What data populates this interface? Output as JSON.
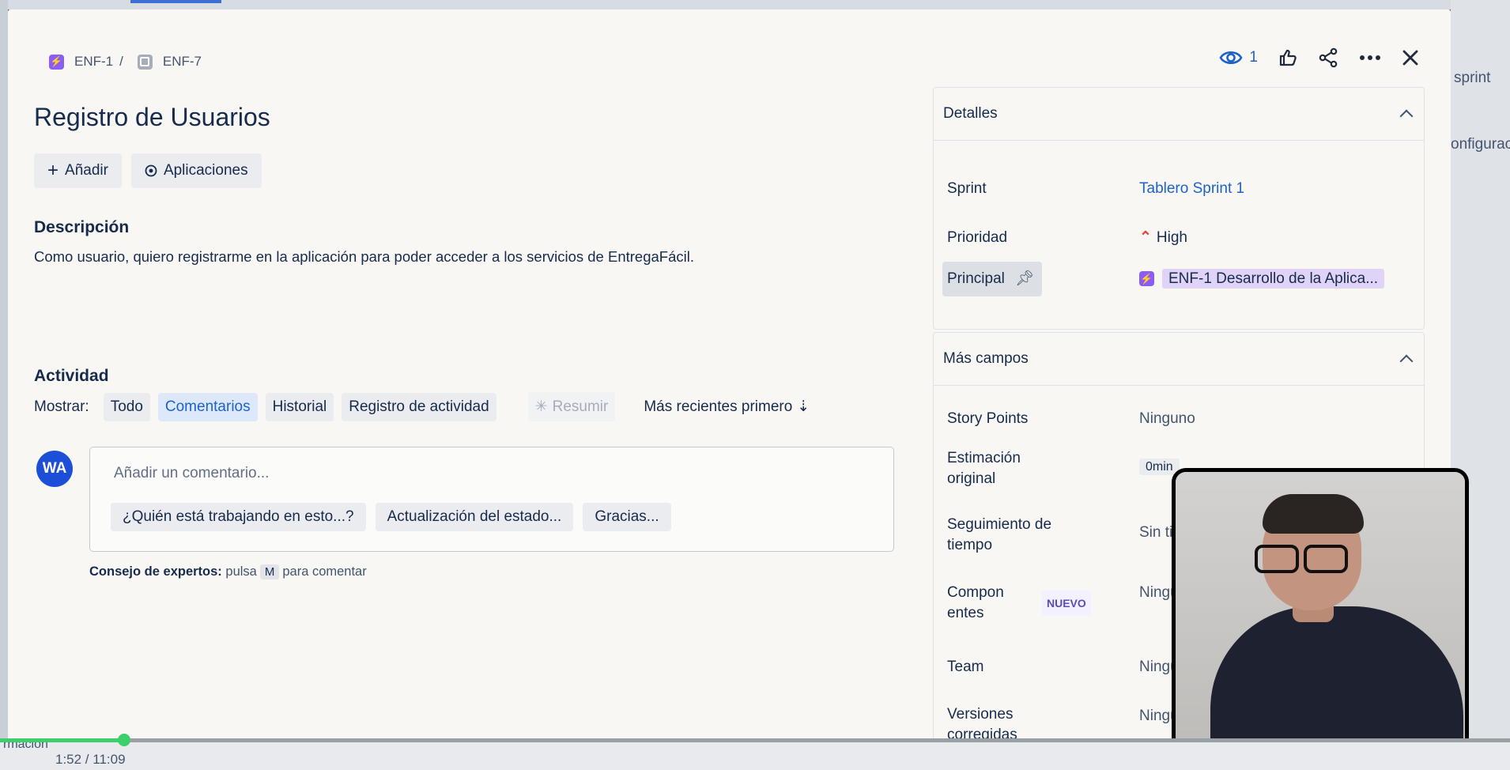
{
  "breadcrumb": {
    "parent": "ENF-1",
    "separator": "/",
    "current": "ENF-7"
  },
  "top_actions": {
    "watch_count": "1"
  },
  "issue": {
    "title": "Registro de Usuarios"
  },
  "buttons": {
    "add": "Añadir",
    "apps": "Aplicaciones"
  },
  "description": {
    "heading": "Descripción",
    "text": "Como usuario, quiero registrarme en la aplicación para poder acceder a los servicios de EntregaFácil."
  },
  "activity": {
    "heading": "Actividad",
    "show_label": "Mostrar:",
    "filters": [
      "Todo",
      "Comentarios",
      "Historial",
      "Registro de actividad"
    ],
    "active_filter": "Comentarios",
    "summarize": "Resumir",
    "sort": "Más recientes primero"
  },
  "comment": {
    "avatar": "WA",
    "placeholder": "Añadir un comentario...",
    "suggestions": [
      "¿Quién está trabajando en esto...?",
      "Actualización del estado...",
      "Gracias..."
    ],
    "tip_bold": "Consejo de expertos:",
    "tip_pre": "pulsa",
    "tip_key": "M",
    "tip_post": "para comentar"
  },
  "details": {
    "heading": "Detalles",
    "sprint_label": "Sprint",
    "sprint_value": "Tablero Sprint 1",
    "priority_label": "Prioridad",
    "priority_value": "High",
    "parent_label": "Principal",
    "parent_value": "ENF-1 Desarrollo de la Aplica..."
  },
  "more_fields": {
    "heading": "Más campos",
    "story_points_label": "Story Points",
    "story_points_value": "Ninguno",
    "estimate_label_1": "Estimación",
    "estimate_label_2": "original",
    "estimate_value": "0min",
    "tracking_label_1": "Seguimiento de",
    "tracking_label_2": "tiempo",
    "tracking_value": "Sin ti",
    "components_label_1": "Compon",
    "components_label_2": "entes",
    "components_badge": "NUEVO",
    "components_value": "Ningu",
    "team_label": "Team",
    "team_value": "Ningu",
    "versions_label_1": "Versiones",
    "versions_label_2": "corregidas",
    "versions_value": "Ningu"
  },
  "background": {
    "right_frag_1": "sprint",
    "right_frag_2": "onfigurac",
    "left_frag": "rmación"
  },
  "player": {
    "progress": 0.082,
    "time": "1:52 / 11:09"
  },
  "colors": {
    "accent": "#1d62c9",
    "epic": "#8b5cf6",
    "progress": "#3ccf6b"
  }
}
